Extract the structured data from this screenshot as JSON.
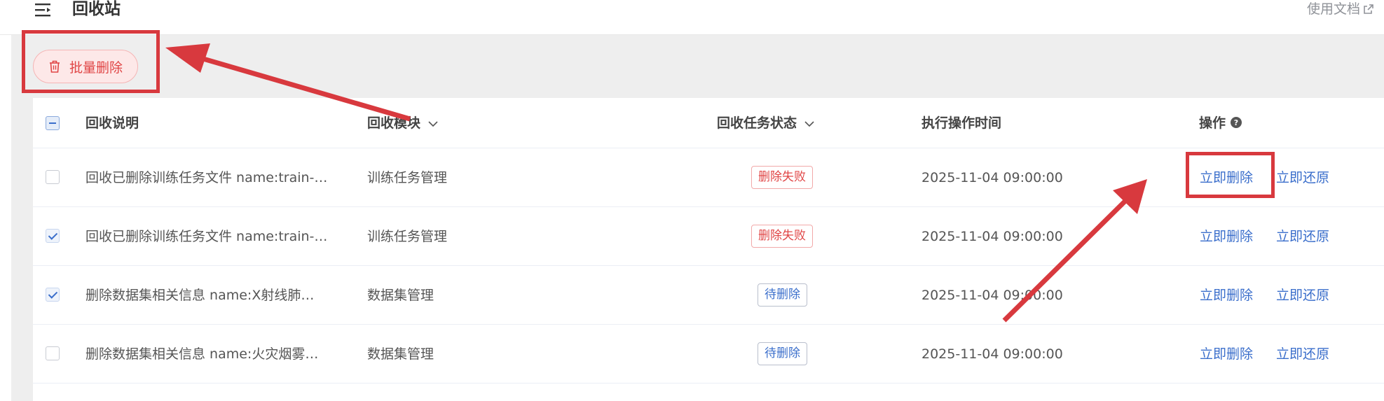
{
  "header": {
    "title": "回收站",
    "doc_link": "使用文档"
  },
  "toolbar": {
    "batch_delete_label": "批量删除"
  },
  "table": {
    "columns": {
      "description": "回收说明",
      "module": "回收模块",
      "status": "回收任务状态",
      "time": "执行操作时间",
      "actions": "操作"
    },
    "rows": [
      {
        "checked": false,
        "description": "回收已删除训练任务文件 name:train-…",
        "module": "训练任务管理",
        "status": "删除失败",
        "status_type": "fail",
        "time": "2025-11-04 09:00:00",
        "delete": "立即删除",
        "restore": "立即还原"
      },
      {
        "checked": true,
        "description": "回收已删除训练任务文件 name:train-…",
        "module": "训练任务管理",
        "status": "删除失败",
        "status_type": "fail",
        "time": "2025-11-04 09:00:00",
        "delete": "立即删除",
        "restore": "立即还原"
      },
      {
        "checked": true,
        "description": "删除数据集相关信息 name:X射线肺…",
        "module": "数据集管理",
        "status": "待删除",
        "status_type": "pending",
        "time": "2025-11-04 09:00:00",
        "delete": "立即删除",
        "restore": "立即还原"
      },
      {
        "checked": false,
        "description": "删除数据集相关信息 name:火灾烟雾…",
        "module": "数据集管理",
        "status": "待删除",
        "status_type": "pending",
        "time": "2025-11-04 09:00:00",
        "delete": "立即删除",
        "restore": "立即还原"
      }
    ]
  },
  "colors": {
    "accent": "#3a6ecb",
    "danger": "#e04545",
    "annotation": "#d8393e"
  }
}
